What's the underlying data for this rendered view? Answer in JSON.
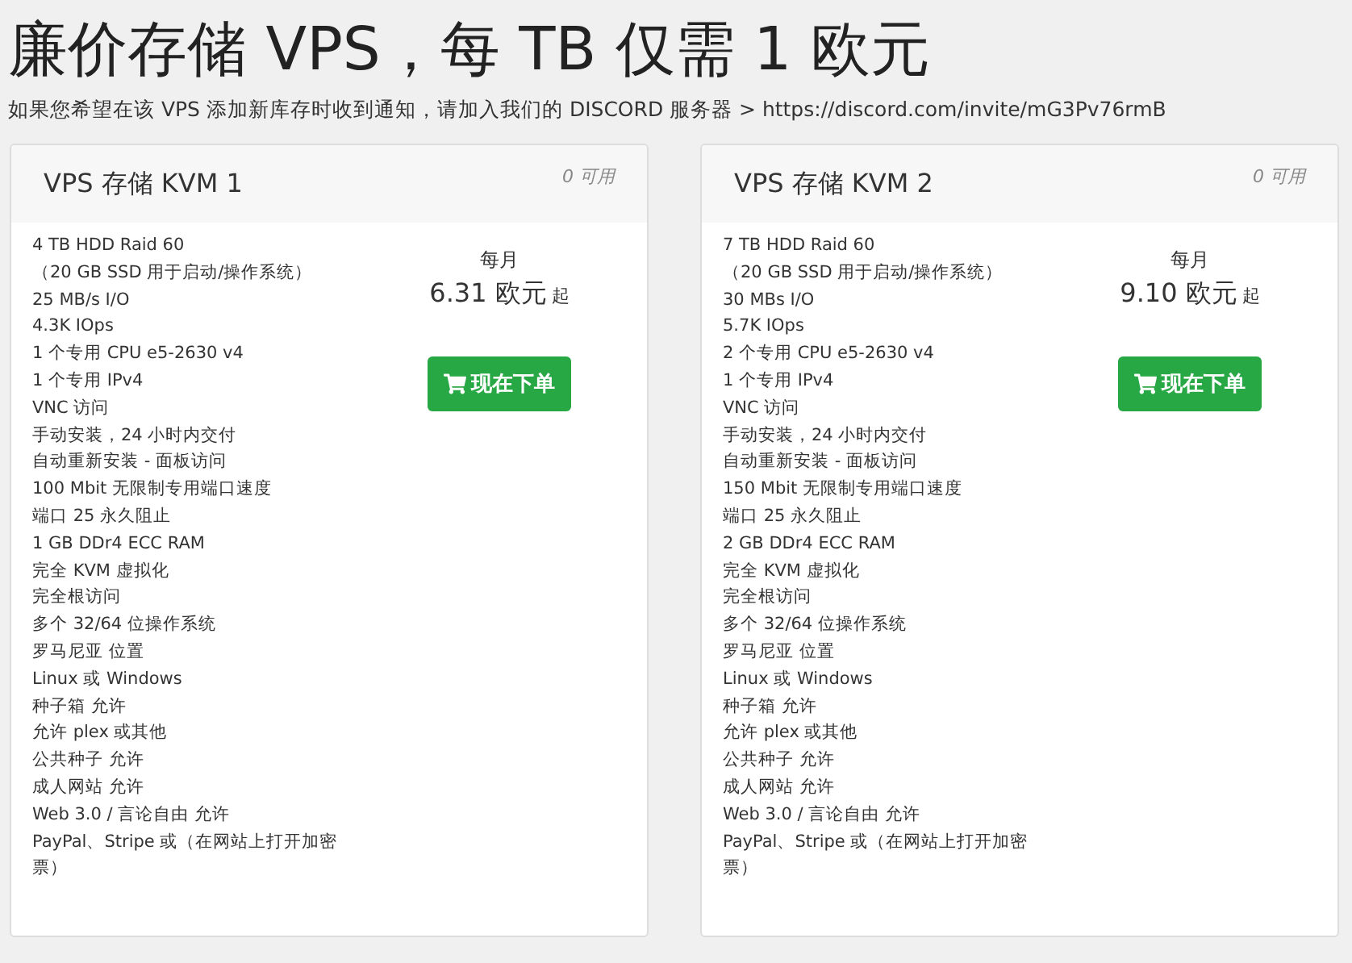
{
  "title": "廉价存储 VPS，每 TB 仅需 1 欧元",
  "notice": "如果您希望在该 VPS 添加新库存时收到通知，请加入我们的 DISCORD 服务器 > https://discord.com/invite/mG3Pv76rmB",
  "plans": [
    {
      "name": "VPS 存储 KVM 1",
      "availability": "0 可用",
      "features": [
        "4 TB HDD Raid 60",
        "（20 GB SSD 用于启动/操作系统）",
        "25 MB/s I/O",
        "4.3K IOps",
        "1 个专用 CPU e5-2630 v4",
        "1 个专用 IPv4",
        "VNC 访问",
        "手动安装，24 小时内交付",
        "自动重新安装 - 面板访问",
        "100 Mbit 无限制专用端口速度",
        "端口 25 永久阻止",
        "1 GB DDr4 ECC RAM",
        "完全 KVM 虚拟化",
        "完全根访问",
        "多个 32/64 位操作系统",
        "罗马尼亚 位置",
        "Linux 或 Windows",
        "种子箱 允许",
        "允许 plex 或其他",
        "公共种子 允许",
        "成人网站 允许",
        "Web 3.0 / 言论自由 允许",
        "PayPal、Stripe 或（在网站上打开加密票）"
      ],
      "period": "每月",
      "price": "6.31 欧元",
      "price_suffix": "起",
      "order_button": "现在下单"
    },
    {
      "name": "VPS 存储 KVM 2",
      "availability": "0 可用",
      "features": [
        "7 TB HDD Raid 60",
        "（20 GB SSD 用于启动/操作系统）",
        "30 MBs I/O",
        "5.7K IOps",
        "2 个专用 CPU e5-2630 v4",
        "1 个专用 IPv4",
        "VNC 访问",
        "手动安装，24 小时内交付",
        "自动重新安装 - 面板访问",
        "150 Mbit 无限制专用端口速度",
        "端口 25 永久阻止",
        "2 GB DDr4 ECC RAM",
        "完全 KVM 虚拟化",
        "完全根访问",
        "多个 32/64 位操作系统",
        "罗马尼亚 位置",
        "Linux 或 Windows",
        "种子箱 允许",
        "允许 plex 或其他",
        "公共种子 允许",
        "成人网站 允许",
        "Web 3.0 / 言论自由 允许",
        "PayPal、Stripe 或（在网站上打开加密票）"
      ],
      "period": "每月",
      "price": "9.10 欧元",
      "price_suffix": "起",
      "order_button": "现在下单"
    }
  ]
}
